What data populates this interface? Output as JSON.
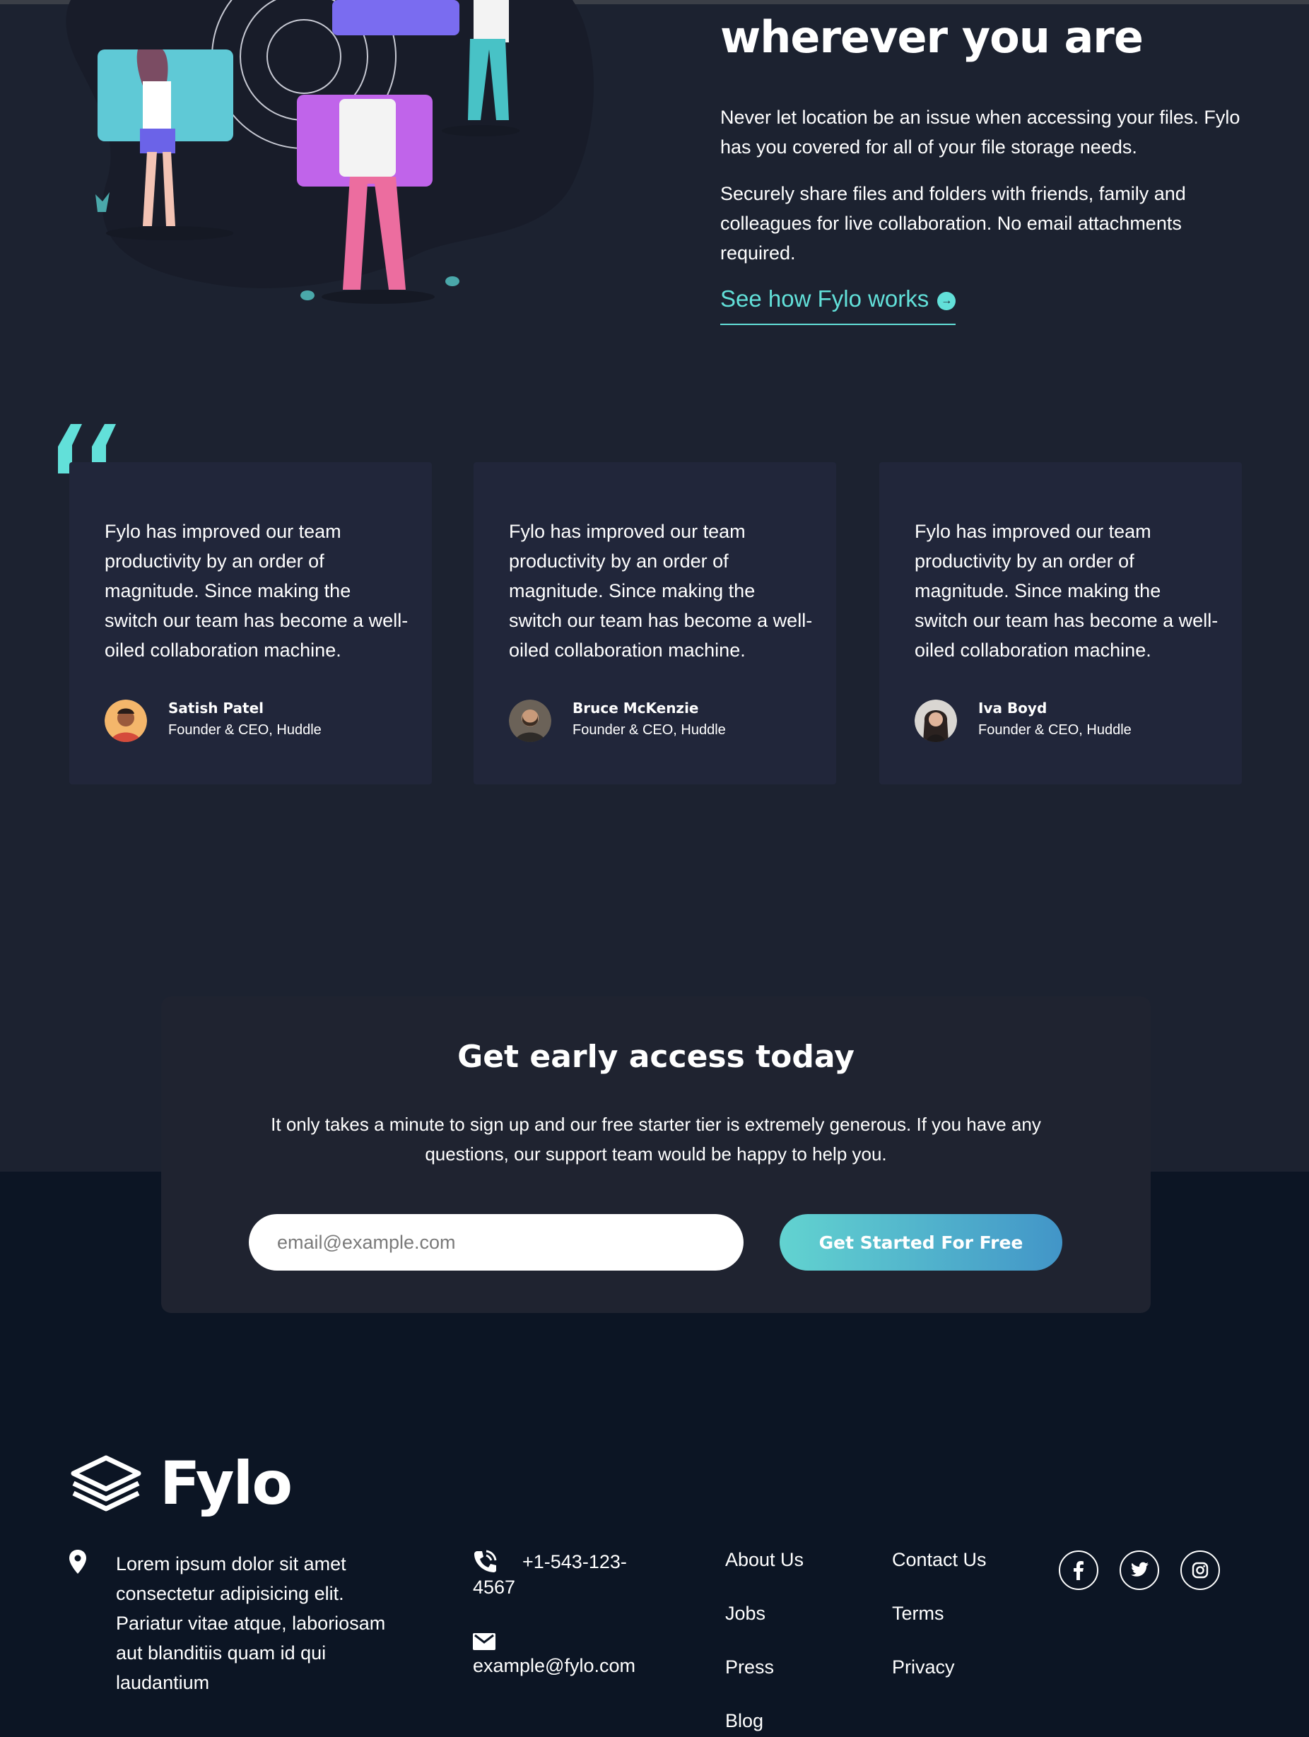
{
  "productive": {
    "heading": "wherever you are",
    "paragraph_1": "Never let location be an issue when accessing your files. Fylo has you covered for all of your file storage needs.",
    "paragraph_2": "Securely share files and folders with friends, family and colleagues for live collaboration. No email attachments required.",
    "link_label": "See how Fylo works"
  },
  "testimonials": [
    {
      "quote": "Fylo has improved our team productivity by an order of magnitude. Since making the switch our team has become a well-oiled collaboration machine.",
      "name": "Satish Patel",
      "role": "Founder & CEO, Huddle"
    },
    {
      "quote": "Fylo has improved our team productivity by an order of magnitude. Since making the switch our team has become a well-oiled collaboration machine.",
      "name": "Bruce McKenzie",
      "role": "Founder & CEO, Huddle"
    },
    {
      "quote": "Fylo has improved our team productivity by an order of magnitude. Since making the switch our team has become a well-oiled collaboration machine.",
      "name": "Iva Boyd",
      "role": "Founder & CEO, Huddle"
    }
  ],
  "early_access": {
    "title": "Get early access today",
    "description": "It only takes a minute to sign up and our free starter tier is extremely generous. If you have any questions, our support team would be happy to help you.",
    "email_placeholder": "email@example.com",
    "button_label": "Get Started For Free"
  },
  "footer": {
    "logo_text": "Fylo",
    "address": "Lorem ipsum dolor sit amet consectetur adipisicing elit. Pariatur vitae atque, laboriosam aut blanditiis quam id qui laudantium",
    "phone": "+1-543-123-4567",
    "email": "example@fylo.com",
    "links_col1": [
      "About Us",
      "Jobs",
      "Press",
      "Blog"
    ],
    "links_col2": [
      "Contact Us",
      "Terms",
      "Privacy"
    ],
    "socials": [
      "facebook-icon",
      "twitter-icon",
      "instagram-icon"
    ]
  },
  "colors": {
    "background_upper": "#1c2230",
    "background_lower": "#0c1524",
    "card": "#21263a",
    "accent": "#62e0d9",
    "button_gradient_start": "#62d3d0",
    "button_gradient_end": "#4295c8"
  }
}
